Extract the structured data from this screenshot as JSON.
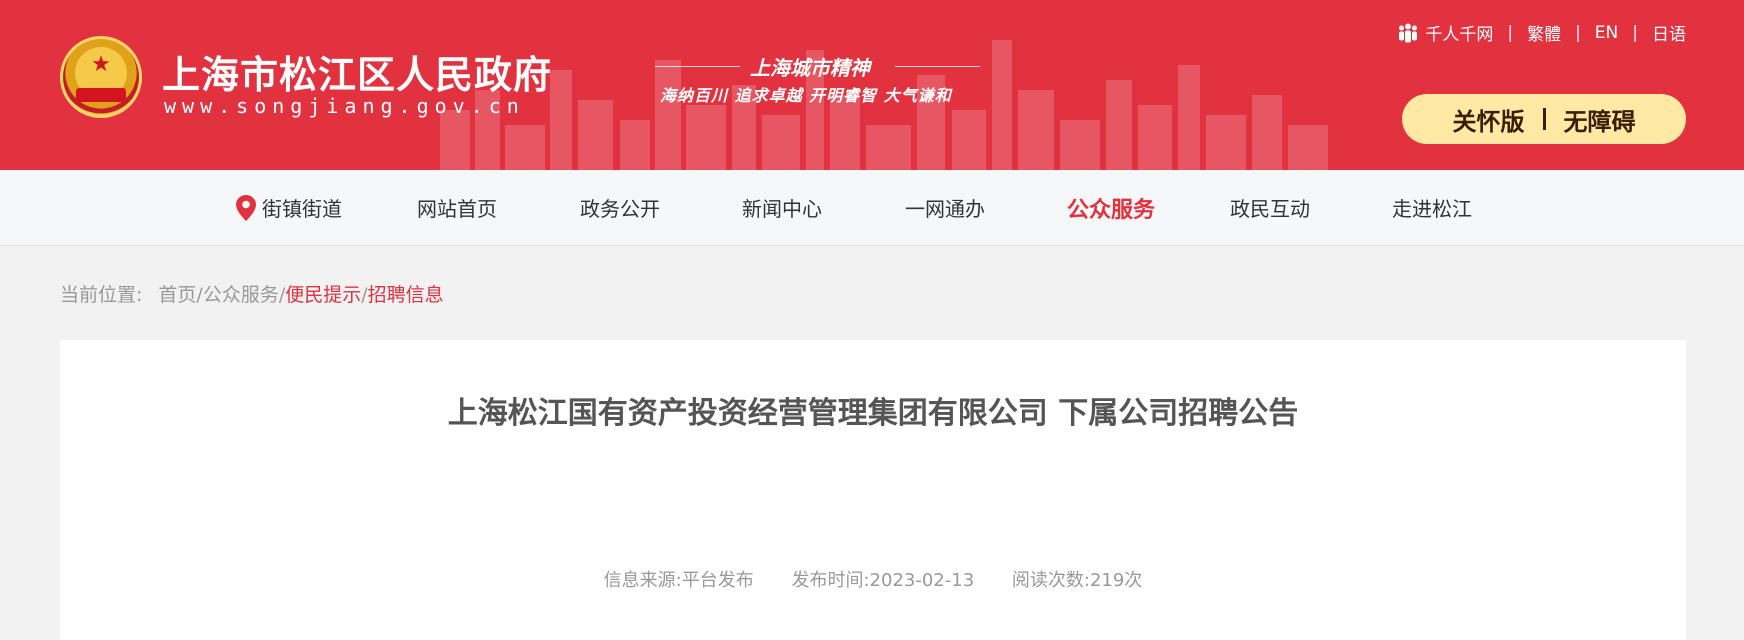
{
  "header": {
    "site_title": "上海市松江区人民政府",
    "site_domain": "www.songjiang.gov.cn",
    "spirit_title": "上海城市精神",
    "spirit_slogan": "海纳百川 追求卓越 开明睿智 大气谦和",
    "top_links": [
      "千人千网",
      "繁體",
      "EN",
      "日语"
    ],
    "care_mode_label": "关怀版",
    "accessibility_label": "无障碍",
    "primary_color": "#e23240",
    "pill_color": "#ffe9a4"
  },
  "nav": {
    "items": [
      {
        "label": "街镇街道",
        "icon": "location-pin-icon"
      },
      {
        "label": "网站首页"
      },
      {
        "label": "政务公开"
      },
      {
        "label": "新闻中心"
      },
      {
        "label": "一网通办"
      },
      {
        "label": "公众服务",
        "active": true
      },
      {
        "label": "政民互动"
      },
      {
        "label": "走进松江"
      }
    ]
  },
  "breadcrumb": {
    "prefix": "当前位置:",
    "home": "首页",
    "level1": "公众服务",
    "level2": "便民提示",
    "level3": "招聘信息",
    "separator": "/"
  },
  "article": {
    "title": "上海松江国有资产投资经营管理集团有限公司 下属公司招聘公告",
    "source": "信息来源:平台发布",
    "publish_date": "发布时间:2023-02-13",
    "read_count": "阅读次数:219次"
  }
}
